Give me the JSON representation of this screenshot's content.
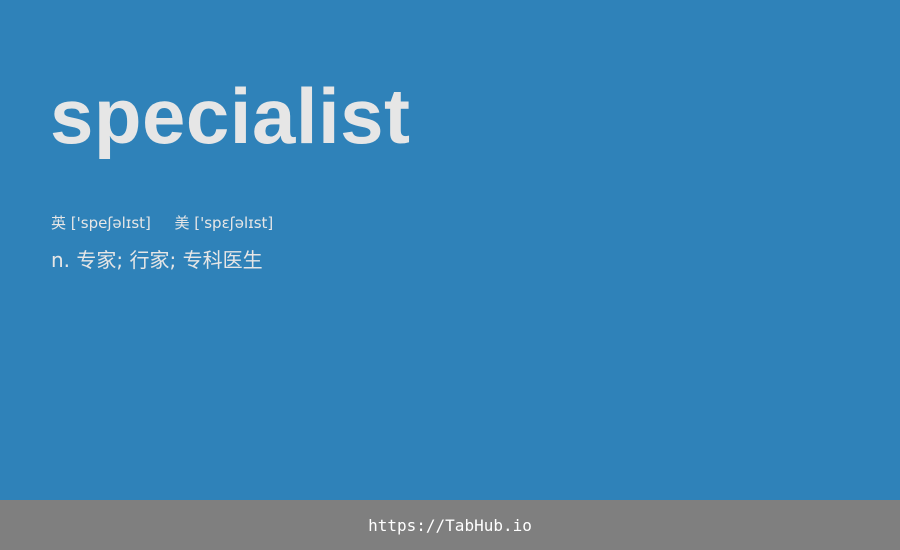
{
  "card": {
    "word": "specialist",
    "phonetic_uk_label": "英",
    "phonetic_uk": "['speʃəlɪst]",
    "phonetic_us_label": "美",
    "phonetic_us": "['spɛʃəlɪst]",
    "definition": "n. 专家; 行家; 专科医生",
    "background_color": "#2f82b9"
  },
  "footer": {
    "link_text": "https://TabHub.io",
    "background_color": "#7f7f7f"
  }
}
